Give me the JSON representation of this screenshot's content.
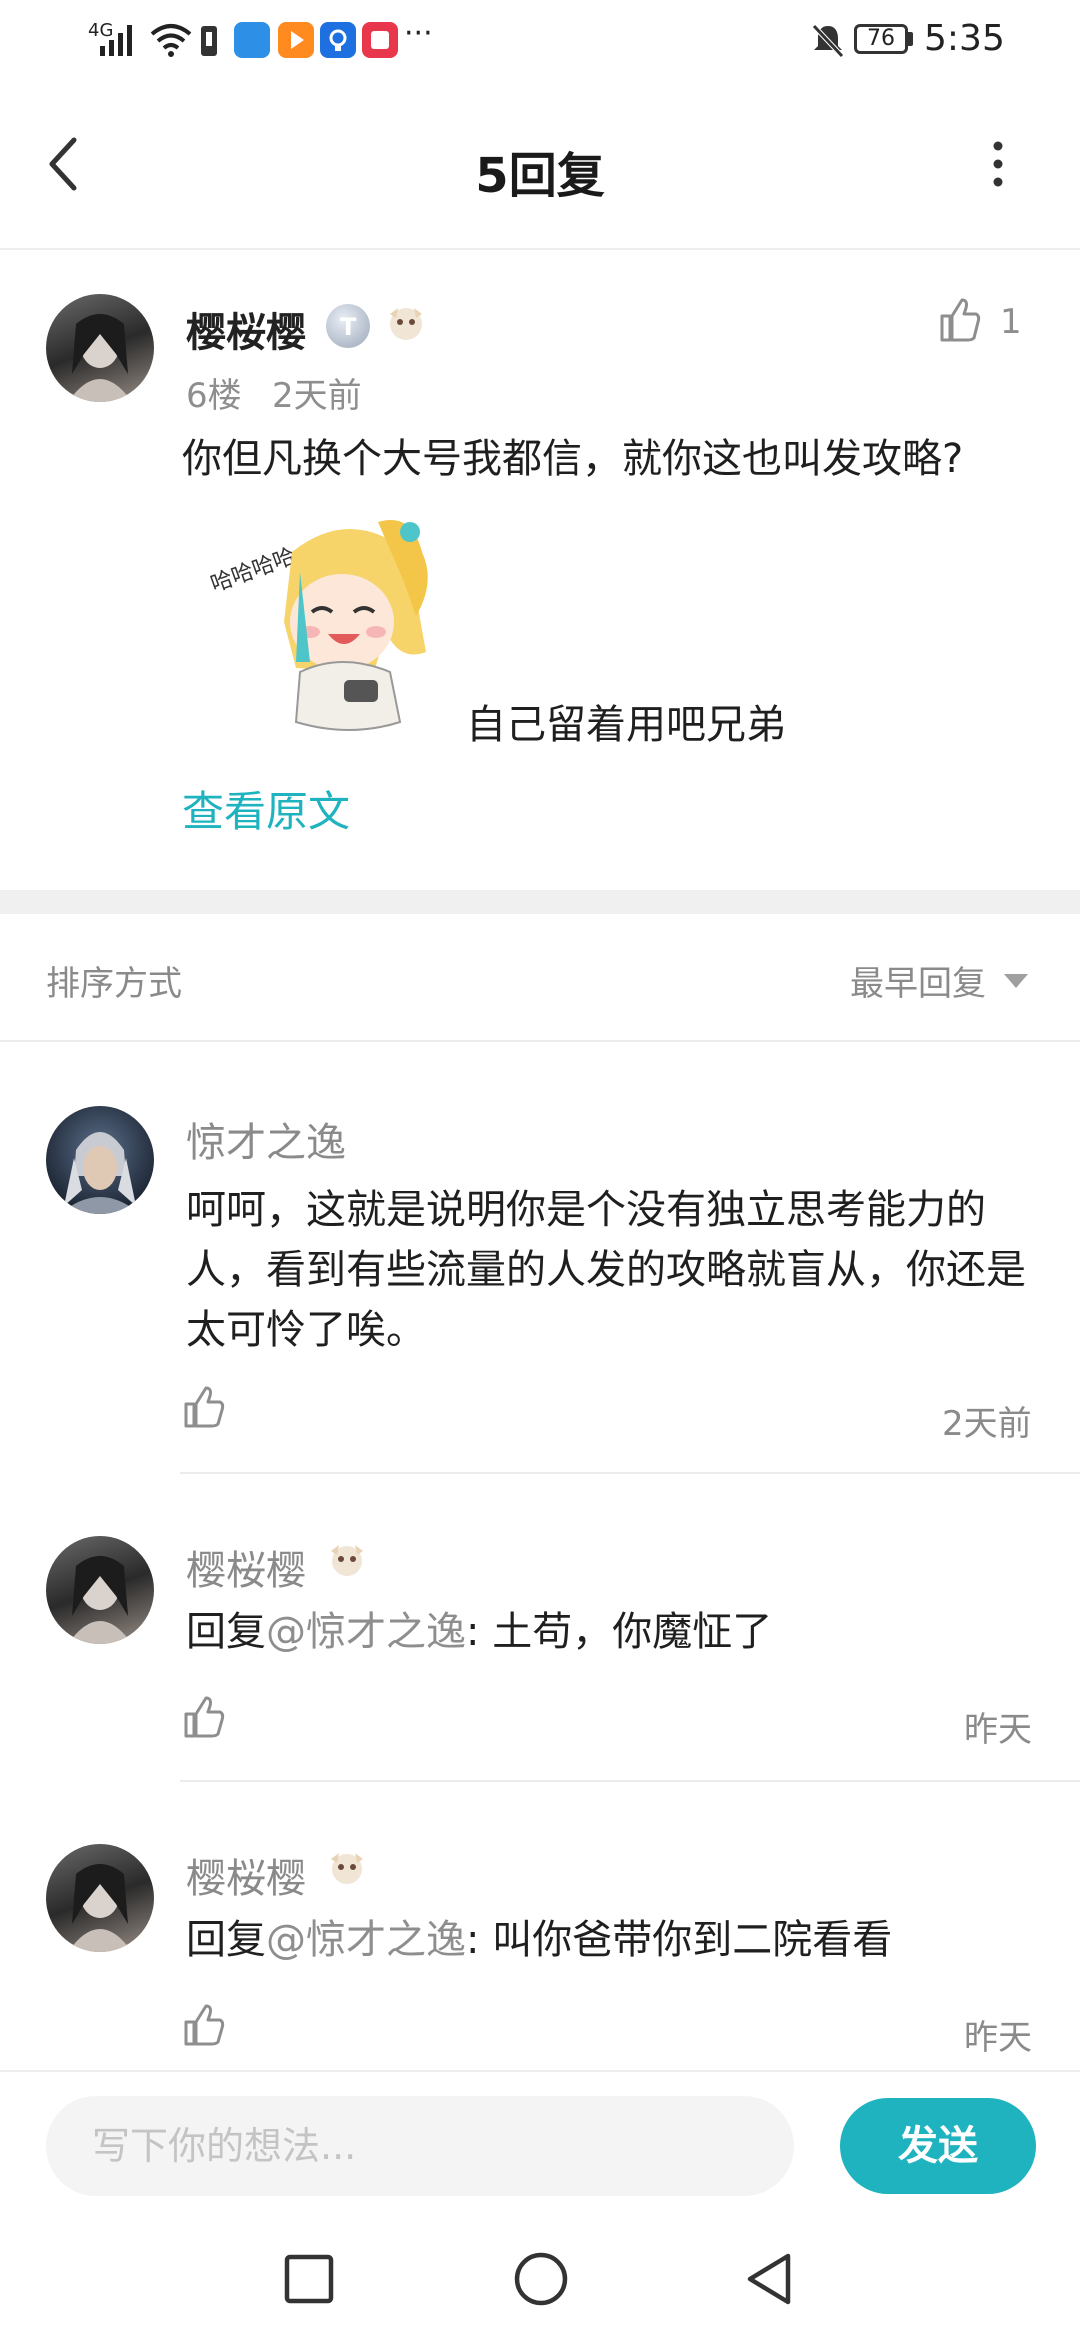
{
  "status_bar": {
    "signal_label": "4G",
    "battery": "76",
    "time": "5:35",
    "more": "···"
  },
  "header": {
    "title": "5回复"
  },
  "main_post": {
    "author": "樱桜樱",
    "floor": "6楼",
    "time": "2天前",
    "like_count": "1",
    "text": "你但凡换个大号我都信，就你这也叫发攻略?",
    "sticker_caption": "自己留着用吧兄弟",
    "view_original": "查看原文",
    "sticker_sound": "哈哈哈哈…"
  },
  "sort": {
    "label": "排序方式",
    "value": "最早回复"
  },
  "replies": [
    {
      "author": "惊才之逸",
      "text": "呵呵，这就是说明你是个没有独立思考能力的人，看到有些流量的人发的攻略就盲从，你还是太可怜了唉。",
      "time": "2天前"
    },
    {
      "author": "樱桜樱",
      "prefix": "回复",
      "mention": "@惊才之逸",
      "body": ": 土苟，你魔怔了",
      "time": "昨天"
    },
    {
      "author": "樱桜樱",
      "prefix": "回复",
      "mention": "@惊才之逸",
      "body": ": 叫你爸带你到二院看看",
      "time": "昨天"
    }
  ],
  "composer": {
    "placeholder": "写下你的想法...",
    "send_label": "发送"
  },
  "colors": {
    "accent": "#1eb3bf",
    "grey_text": "#8e8e8e",
    "divider": "#ececec"
  },
  "icons": [
    "back-arrow-icon",
    "more-vertical-icon",
    "thumbs-up-icon",
    "caret-down-icon",
    "nav-square-icon",
    "nav-home-circle-icon",
    "nav-back-triangle-icon",
    "mute-bell-icon",
    "wifi-icon",
    "battery-icon"
  ]
}
